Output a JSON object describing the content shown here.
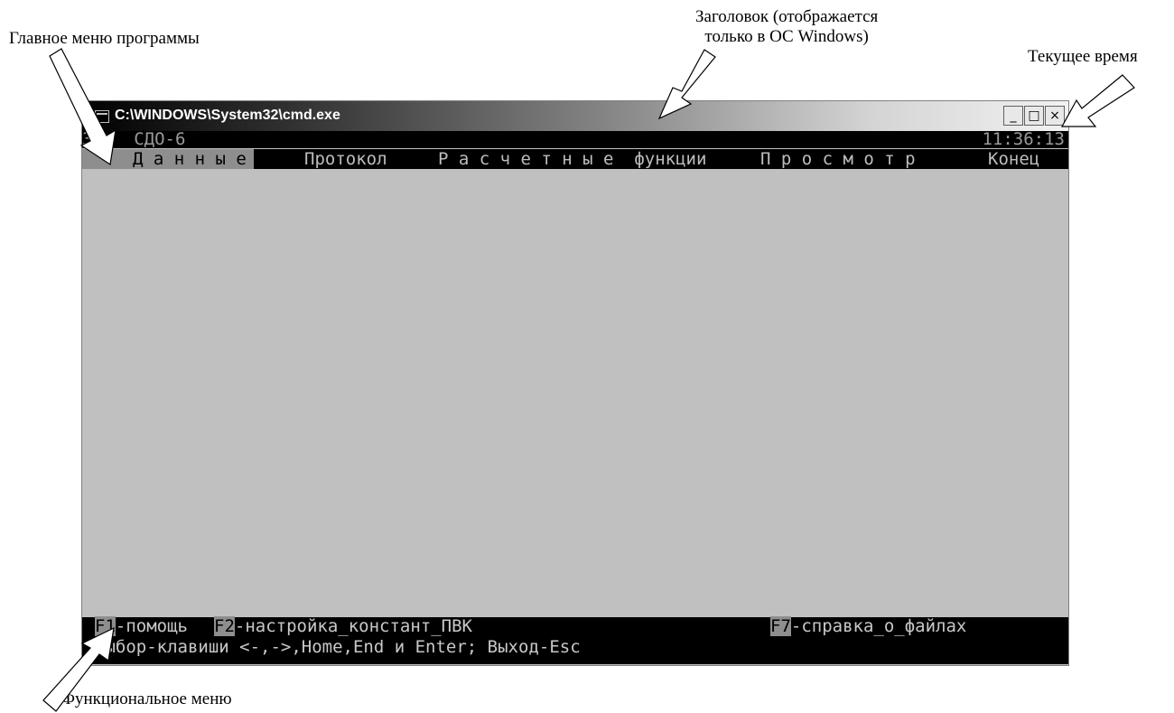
{
  "annotations": {
    "main_menu": "Главное меню программы",
    "title_line1": "Заголовок (отображается",
    "title_line2": "только в ОС Windows)",
    "current_time": "Текущее время",
    "function_menu": "Функциональное меню"
  },
  "window": {
    "title": "C:\\WINDOWS\\System32\\cmd.exe",
    "minimize_glyph": "_",
    "maximize_glyph": "□",
    "close_glyph": "×"
  },
  "console": {
    "top_left": "З К  СДО-6",
    "clock": "11:36:13",
    "menu": [
      "Д а н н ы е",
      "Протокол",
      "Р а с ч е т н ы е  функции",
      "П р о с м о т р",
      "Конец"
    ],
    "fn_keys": [
      {
        "key": "F1",
        "label": "-помощь"
      },
      {
        "key": "F2",
        "label": "-настройка_констант_ПВК"
      },
      {
        "key": "F7",
        "label": "-справка_о_файлах"
      }
    ],
    "hint": "Выбор-клавиши <-,->,Home,End и Enter; Выход-Esc"
  },
  "colors": {
    "console_bg": "#c0c0c0",
    "bar_bg": "#000000",
    "highlight": "#8e8e8e"
  }
}
